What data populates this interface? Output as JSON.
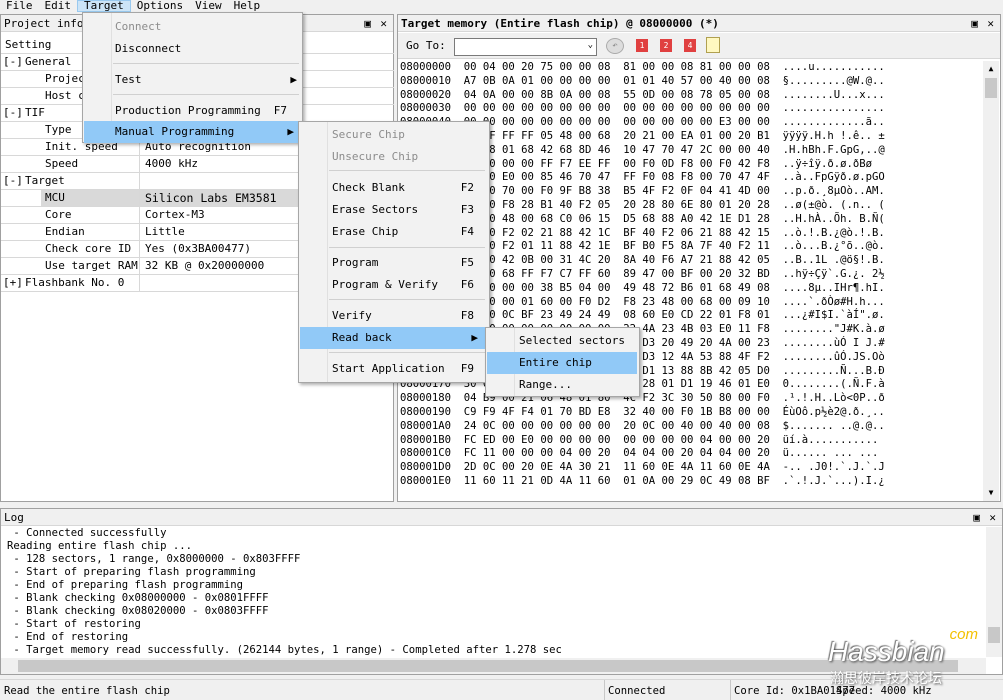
{
  "menubar": {
    "file": "File",
    "edit": "Edit",
    "target": "Target",
    "options": "Options",
    "view": "View",
    "help": "Help"
  },
  "project": {
    "title": "Project information",
    "setting_header": "Setting",
    "general": "General",
    "project": "Project",
    "host": "Host c",
    "tif": "TIF",
    "type": "Type",
    "init_speed_label": "Init. speed",
    "init_speed": "Auto recognition",
    "speed_label": "Speed",
    "speed": "4000 kHz",
    "target": "Target",
    "mcu_label": "MCU",
    "mcu": "Silicon Labs EM3581",
    "core_label": "Core",
    "core": "Cortex-M3",
    "endian_label": "Endian",
    "endian": "Little",
    "checkcore_label": "Check core ID",
    "checkcore": "Yes (0x3BA00477)",
    "ram_label": "Use target RAM",
    "ram": "32 KB @ 0x20000000",
    "flashbank": "Flashbank No. 0",
    "toggle_minus": "[-]",
    "toggle_plus": "[+]"
  },
  "memory": {
    "title": "Target memory (Entire flash chip) @ 08000000 (*)",
    "goto_label": "Go To:",
    "rows": [
      "08000000  00 04 00 20 75 00 00 08  81 00 00 08 81 00 00 08  ....u...........",
      "08000010  A7 0B 0A 01 00 00 00 00  01 01 40 57 00 40 00 08  §.........@W.@..",
      "08000020  04 0A 00 00 8B 0A 00 08  55 0D 00 08 78 05 00 08  ........U...x...",
      "08000030  00 00 00 00 00 00 00 00  00 00 00 00 00 00 00 00  ................",
      "08000040  00 00 00 00 00 00 00 00  00 00 00 00 00 E3 00 00  .............ã..",
      "08000050  FF FF FF FF 05 48 00 68  20 21 00 EA 01 00 20 B1  ÿÿÿÿ.H.h !.ê.. ±",
      "08000060  00 48 01 68 42 68 8D 46  10 47 70 47 2C 00 00 40  .H.hBh.F.GpG,..@",
      "08000070  00 00 00 00 FF F7 EE FF  00 F0 0D F8 00 F0 42 F8  ..ÿ÷îÿ.ð.ø.ðBø",
      "08000080  00 00 E0 00 85 46 70 47  FF F0 08 F8 00 70 47 4F  ..à..FpGÿð.ø.pGO",
      "08000090  00 00 70 00 F0 9F B8 38  B5 4F F2 0F 04 41 4D 00  ..p.ð.¸8µOò..AM.",
      "080000A0  00 00 F8 28 B1 40 F2 05  20 28 80 6E 80 01 20 28  ..ø(±@ò. (.n.. (",
      "080000B0  00 00 48 00 68 C0 06 15  D5 68 88 A0 42 1E D1 28  ..H.hÀ..Õh. B.Ñ(",
      "080000C0  00 00 F2 02 21 88 42 1C  BF 40 F2 06 21 88 42 15  ..ò.!.B.¿@ò.!.B.",
      "080000D0  00 00 F2 01 11 88 42 1E  BF B0 F5 8A 7F 40 F2 11  ..ò...B.¿°õ..@ò.",
      "080000E0  00 00 42 0B 00 31 4C 20  8A 40 F6 A7 21 88 42 05  ..B..1L .@ö§!.B.",
      "080000F0  00 00 68 FF F7 C7 FF 60  89 47 00 BF 00 20 32 BD  ..hÿ÷Çÿ`.G.¿. 2½",
      "08000100  00 00 00 00 38 B5 04 00  49 48 72 B6 01 68 49 08  ....8µ..IHr¶.hI.",
      "08000110  00 00 00 01 60 00 F0 D2  F8 23 48 00 68 00 09 10  ....`.ðÒø#H.h...",
      "08000120  00 00 0C BF 23 49 24 49  08 60 E0 CD 22 01 F8 01  ...¿#I$I.`àÍ\".ø.",
      "08000130  00 00 00 00 00 00 00 00  22 4A 23 4B 03 E0 11 F8  ........\"J#K.à.ø",
      "08000140  00 00 00 00 00 00 00 00  F9 D3 20 49 20 4A 00 23  ........ùÓ I J.#",
      "08000150  00 00 00 00 00 00 00 00  FB D3 12 4A 53 88 4F F2  ........ûÓ.JS.Oò",
      "08000160  00 00 00 00 00 00 00 00  0A D1 13 88 8B 42 05 D0  .........Ñ...B.Ð",
      "08000170  30 00 00 00 00 00 00 00  02 28 01 D1 19 46 01 E0  0........(.Ñ.F.à",
      "08000180  04 B9 00 21 06 48 01 80  4C F2 3C 30 50 80 00 F0  .¹.!.H..Lò<0P..ð",
      "08000190  C9 F9 4F F4 01 70 BD E8  32 40 00 F0 1B B8 00 00  ÉùOô.p½è2@.ð.¸..",
      "080001A0  24 0C 00 00 00 00 00 00  20 0C 00 40 00 40 00 08  $....... ..@.@..",
      "080001B0  FC ED 00 E0 00 00 00 00  00 00 00 00 04 00 00 20  üí.à........... ",
      "080001C0  FC 11 00 00 00 04 00 20  04 04 00 20 04 04 00 20  ü...... ... ... ",
      "080001D0  2D 0C 00 20 0E 4A 30 21  11 60 0E 4A 11 60 0E 4A  -.. .J0!.`.J.`.J",
      "080001E0  11 60 11 21 0D 4A 11 60  01 0A 00 29 0C 49 08 BF  .`.!.J.`...).I.¿"
    ]
  },
  "target_menu": {
    "connect": "Connect",
    "disconnect": "Disconnect",
    "test": "Test",
    "production": "Production Programming",
    "production_sc": "F7",
    "manual": "Manual Programming"
  },
  "manual_menu": {
    "secure": "Secure Chip",
    "unsecure": "Unsecure Chip",
    "check_blank": "Check Blank",
    "check_blank_sc": "F2",
    "erase_sectors": "Erase Sectors",
    "erase_sectors_sc": "F3",
    "erase_chip": "Erase Chip",
    "erase_chip_sc": "F4",
    "program": "Program",
    "program_sc": "F5",
    "program_verify": "Program & Verify",
    "program_verify_sc": "F6",
    "verify": "Verify",
    "verify_sc": "F8",
    "read_back": "Read back",
    "start_app": "Start Application",
    "start_app_sc": "F9"
  },
  "readback_menu": {
    "selected": "Selected sectors",
    "entire": "Entire chip",
    "range": "Range..."
  },
  "log": {
    "title": "Log",
    "lines": [
      " - Connected successfully",
      "Reading entire flash chip ...",
      " - 128 sectors, 1 range, 0x8000000 - 0x803FFFF",
      " - Start of preparing flash programming",
      " - End of preparing flash programming",
      " - Blank checking 0x08000000 - 0x0801FFFF",
      " - Blank checking 0x08020000 - 0x0803FFFF",
      " - Start of restoring",
      " - End of restoring",
      " - Target memory read successfully. (262144 bytes, 1 range) - Completed after 1.278 sec"
    ]
  },
  "status": {
    "left": "Read the entire flash chip",
    "conn": "Connected",
    "core": "Core Id: 0x1BA01477",
    "speed": "Speed: 4000 kHz"
  },
  "watermark": {
    "main": "Hassbian",
    "com": "com",
    "cn": "瀚思彼岸技术论坛"
  }
}
